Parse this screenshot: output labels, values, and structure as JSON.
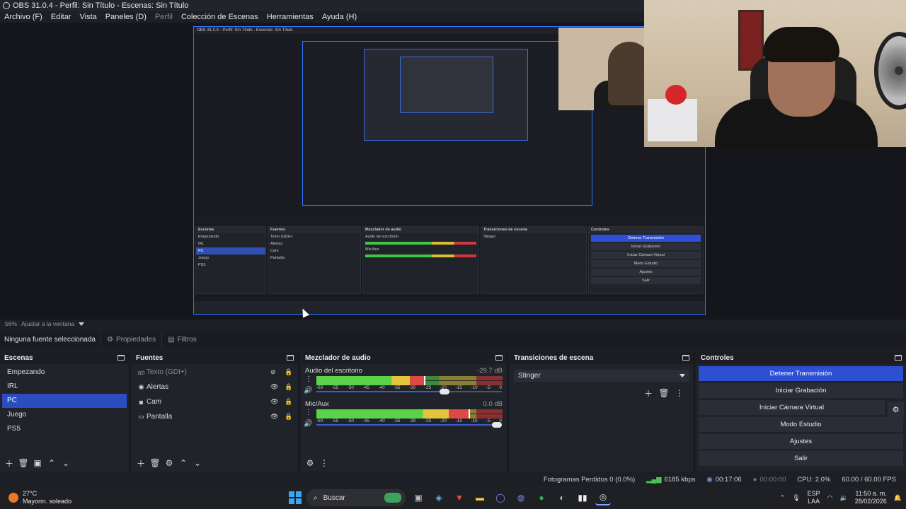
{
  "window": {
    "title": "OBS 31.0.4 - Perfil: Sin Título - Escenas: Sin Título"
  },
  "menu": [
    {
      "label": "Archivo (F)",
      "disabled": false
    },
    {
      "label": "Editar",
      "disabled": false
    },
    {
      "label": "Vista",
      "disabled": false
    },
    {
      "label": "Paneles (D)",
      "disabled": false
    },
    {
      "label": "Perfil",
      "disabled": true
    },
    {
      "label": "Colección de Escenas",
      "disabled": false
    },
    {
      "label": "Herramientas",
      "disabled": false
    },
    {
      "label": "Ayuda (H)",
      "disabled": false
    }
  ],
  "preview": {
    "zoom": "56%",
    "zoom_option": "Ajustar a la ventana",
    "nested_title": "OBS 31.0.4 - Perfil: Sin Título - Escenas: Sin Título"
  },
  "props_bar": {
    "selected_source": "Ninguna fuente seleccionada",
    "properties_label": "Propiedades",
    "filters_label": "Filtros"
  },
  "scenes": {
    "title": "Escenas",
    "items": [
      "Empezando",
      "IRL",
      "PC",
      "Juego",
      "PS5"
    ],
    "active": "PC"
  },
  "sources": {
    "title": "Fuentes",
    "items": [
      {
        "label": "Texto (GDI+)",
        "icon": "text-icon",
        "visible": false
      },
      {
        "label": "Alertas",
        "icon": "globe-icon",
        "visible": true
      },
      {
        "label": "Cam",
        "icon": "camera-icon",
        "visible": true
      },
      {
        "label": "Pantalla",
        "icon": "monitor-icon",
        "visible": true
      }
    ]
  },
  "mixer": {
    "title": "Mezclador de audio",
    "channels": [
      {
        "name": "Audio del escritorio",
        "db": "-29.7 dB",
        "level": 0.58,
        "volume": 0.7
      },
      {
        "name": "Mic/Aux",
        "db": "0.0 dB",
        "level": 0.82,
        "volume": 1.0
      }
    ],
    "ticks": [
      "-60",
      "-55",
      "-50",
      "-45",
      "-40",
      "-35",
      "-30",
      "-25",
      "-20",
      "-15",
      "-10",
      "-5",
      "0"
    ]
  },
  "transitions": {
    "title": "Transiciones de escena",
    "selected": "Stinger"
  },
  "controls": {
    "title": "Controles",
    "buttons": {
      "stream": "Detener Transmisión",
      "record": "Iniciar Grabación",
      "virtual_cam": "Iniciar Cámara Virtual",
      "studio": "Modo Estudio",
      "settings": "Ajustes",
      "exit": "Salir"
    }
  },
  "status": {
    "dropped": "Fotogramas Perdidos 0 (0.0%)",
    "bitrate": "6185 kbps",
    "stream_time": "00:17:06",
    "record_time": "00:00:00",
    "cpu": "CPU: 2.0%",
    "fps": "60.00 / 60.00 FPS"
  },
  "taskbar": {
    "temp": "27°C",
    "weather": "Mayorm. soleado",
    "search": "Buscar",
    "lang_1": "ESP",
    "lang_2": "LAA",
    "time": "11:50 a. m.",
    "date": "28/02/2026"
  }
}
